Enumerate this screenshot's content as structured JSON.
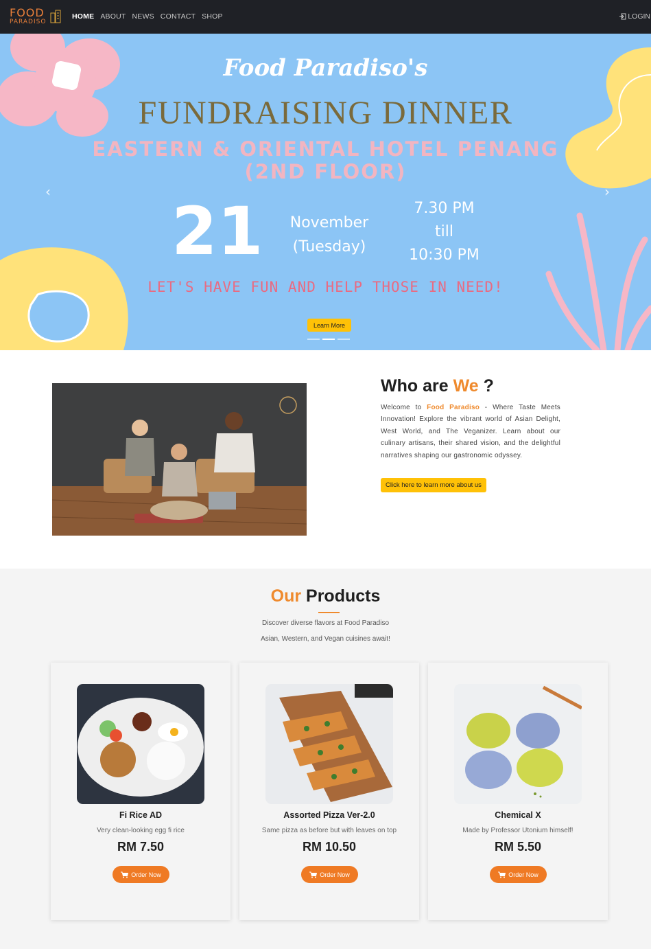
{
  "nav": {
    "logo_line1": "FOOD",
    "logo_line2": "PARADISO",
    "links": [
      "HOME",
      "ABOUT",
      "NEWS",
      "CONTACT",
      "SHOP"
    ],
    "active": "HOME",
    "login_label": "LOGIN",
    "login_icon": "login-icon"
  },
  "hero": {
    "script_title": "Food Paradiso's",
    "title": "FUNDRAISING DINNER",
    "venue_line1": "EASTERN & ORIENTAL HOTEL PENANG",
    "venue_line2": "(2ND FLOOR)",
    "day": "21",
    "month": "November",
    "weekday": "(Tuesday)",
    "time_start": "7.30 PM",
    "time_sep": "till",
    "time_end": "10:30 PM",
    "slogan": "LET'S HAVE FUN AND HELP THOSE IN NEED!",
    "button_label": "Learn More",
    "prev_icon": "chevron-left-icon",
    "next_icon": "chevron-right-icon",
    "prev_glyph": "‹",
    "next_glyph": "›",
    "slide_count": 3,
    "active_slide": 2,
    "colors": {
      "background": "#8cc5f5",
      "title": "#7a6a3b",
      "venue": "#f2b5c1",
      "slogan": "#e96b82",
      "button": "#ffc107"
    }
  },
  "about": {
    "title_prefix": "Who are ",
    "title_accent": "We",
    "title_suffix": " ?",
    "text_intro": "Welcome to ",
    "text_brand": "Food Paradiso",
    "text_body": " - Where Taste Meets Innovation! Explore the vibrant world of Asian Delight, West World, and The Veganizer. Learn about our culinary artisans, their shared vision, and the delightful narratives shaping our gastronomic odyssey.",
    "button_label": "Click here to learn more about us"
  },
  "products": {
    "title_accent": "Our",
    "title_rest": " Products",
    "subtitle1": "Discover diverse flavors at Food Paradiso",
    "subtitle2": "Asian, Western, and Vegan cuisines await!",
    "items": [
      {
        "name": "Fi Rice AD",
        "description": "Very clean-looking egg fi rice",
        "price": "RM 7.50",
        "button": "Order Now"
      },
      {
        "name": "Assorted Pizza Ver-2.0",
        "description": "Same pizza as before but with leaves on top",
        "price": "RM 10.50",
        "button": "Order Now"
      },
      {
        "name": "Chemical X",
        "description": "Made by Professor Utonium himself!",
        "price": "RM 5.50",
        "button": "Order Now"
      }
    ],
    "accent_color": "#ef8a2d",
    "cart_icon": "cart-icon"
  }
}
